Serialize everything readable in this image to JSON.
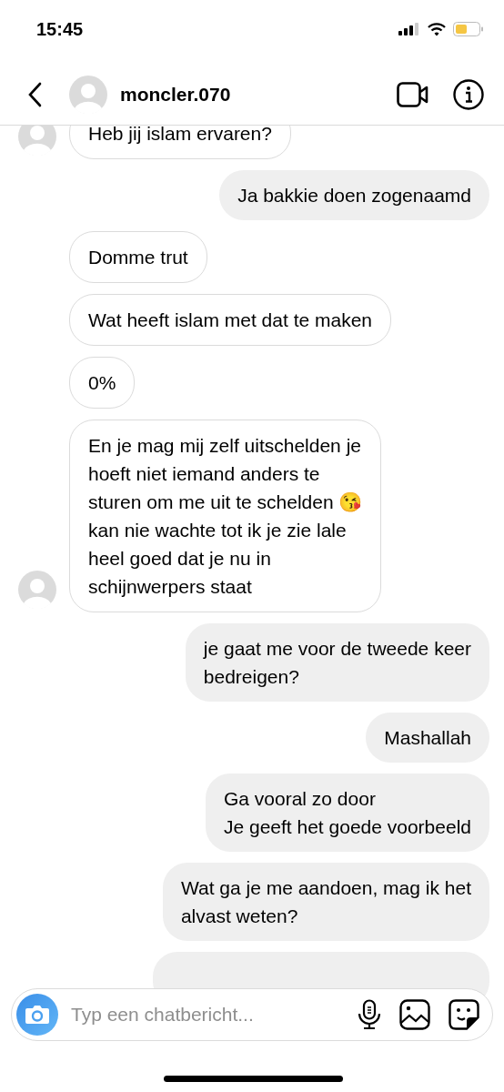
{
  "status_bar": {
    "time": "15:45"
  },
  "header": {
    "username": "moncler.070"
  },
  "messages": [
    {
      "kind": "received",
      "text": "Heb jij islam ervaren?"
    },
    {
      "kind": "sent",
      "text": "Ja bakkie doen zogenaamd"
    },
    {
      "kind": "received",
      "text": "Domme trut"
    },
    {
      "kind": "received",
      "text": "Wat heeft islam met dat te maken"
    },
    {
      "kind": "received",
      "text": "0%"
    },
    {
      "kind": "received",
      "text": "En je mag mij zelf uitschelden je\nhoeft niet iemand anders te\nsturen om me uit te schelden 😘\nkan nie wachte tot ik je zie lale\nheel goed dat je nu in\nschijnwerpers staat"
    },
    {
      "kind": "sent",
      "text": "je gaat me voor de tweede keer\nbedreigen?"
    },
    {
      "kind": "sent",
      "text": "Mashallah"
    },
    {
      "kind": "sent",
      "text": "Ga vooral zo door\nJe geeft het goede voorbeeld"
    },
    {
      "kind": "sent",
      "text": "Wat ga je me aandoen, mag ik het\nalvast weten?"
    },
    {
      "kind": "sent_hidden"
    }
  ],
  "composer": {
    "placeholder": "Typ een chatbericht..."
  }
}
